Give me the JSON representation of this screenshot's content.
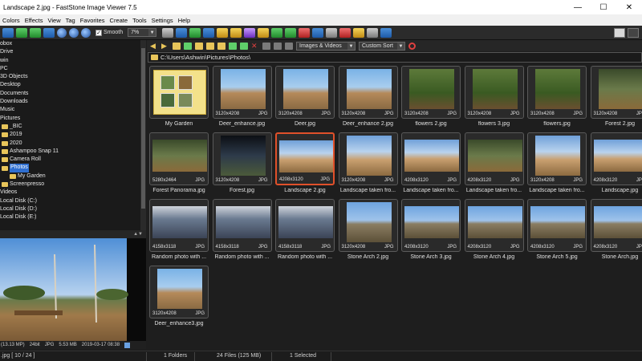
{
  "window": {
    "title": "Landscape 2.jpg  -  FastStone Image Viewer 7.5",
    "minimize": "—",
    "maximize": "☐",
    "close": "✕"
  },
  "menu": [
    "Colors",
    "Effects",
    "View",
    "Tag",
    "Favorites",
    "Create",
    "Tools",
    "Settings",
    "Help"
  ],
  "toolbar": {
    "smooth_label": "Smooth",
    "smooth_checked": "✓",
    "zoom_value": "7%"
  },
  "nav": {
    "view_mode": "Images & Videos",
    "sort": "Custom Sort"
  },
  "path": "C:\\Users\\Ashwin\\Pictures\\Photos\\",
  "tree": [
    {
      "label": "obox",
      "indent": 0,
      "folder": false
    },
    {
      "label": "Drive",
      "indent": 0,
      "folder": false
    },
    {
      "label": "win",
      "indent": 0,
      "folder": false
    },
    {
      "label": "PC",
      "indent": 0,
      "folder": false
    },
    {
      "label": "3D Objects",
      "indent": 0,
      "folder": false
    },
    {
      "label": "Desktop",
      "indent": 0,
      "folder": false
    },
    {
      "label": "Documents",
      "indent": 0,
      "folder": false
    },
    {
      "label": "Downloads",
      "indent": 0,
      "folder": false
    },
    {
      "label": "Music",
      "indent": 0,
      "folder": false
    },
    {
      "label": "Pictures",
      "indent": 0,
      "folder": false
    },
    {
      "label": "_BIC",
      "indent": 1,
      "folder": true
    },
    {
      "label": "2019",
      "indent": 1,
      "folder": true
    },
    {
      "label": "2020",
      "indent": 1,
      "folder": true
    },
    {
      "label": "Ashampoo Snap 11",
      "indent": 1,
      "folder": true
    },
    {
      "label": "Camera Roll",
      "indent": 1,
      "folder": true
    },
    {
      "label": "Photos",
      "indent": 1,
      "folder": true,
      "selected": true
    },
    {
      "label": "My Garden",
      "indent": 2,
      "folder": true
    },
    {
      "label": "Screenpresso",
      "indent": 1,
      "folder": true
    },
    {
      "label": "Videos",
      "indent": 0,
      "folder": false
    },
    {
      "label": "Local Disk (C:)",
      "indent": 0,
      "folder": false
    },
    {
      "label": "Local Disk (D:)",
      "indent": 0,
      "folder": false
    },
    {
      "label": "Local Disk (E:)",
      "indent": 0,
      "folder": false
    }
  ],
  "preview_info": {
    "megapixels": "(13.13 MP)",
    "bitdepth": "24bit",
    "format": "JPG",
    "size": "5.53 MB",
    "date": "2019-03-17 08:38",
    "index": ".jpg [ 10 / 24 ]"
  },
  "thumbnails": [
    {
      "name": "My Garden",
      "dims": "",
      "ext": "",
      "kind": "folder"
    },
    {
      "name": "Deer_enhance.jpg",
      "dims": "3120x4208",
      "ext": "JPG",
      "kind": "img-sky"
    },
    {
      "name": "Deer.jpg",
      "dims": "3120x4208",
      "ext": "JPG",
      "kind": "img-sky"
    },
    {
      "name": "Deer_enhance 2.jpg",
      "dims": "3120x4208",
      "ext": "JPG",
      "kind": "img-sky"
    },
    {
      "name": "flowers 2.jpg",
      "dims": "3120x4208",
      "ext": "JPG",
      "kind": "img-green"
    },
    {
      "name": "flowers 3.jpg",
      "dims": "3120x4208",
      "ext": "JPG",
      "kind": "img-green"
    },
    {
      "name": "flowers.jpg",
      "dims": "3120x4208",
      "ext": "JPG",
      "kind": "img-green"
    },
    {
      "name": "Forest 2.jpg",
      "dims": "3120x4208",
      "ext": "JPG",
      "kind": "img-forest"
    },
    {
      "name": "Forest Panorama.jpg",
      "dims": "5280x2464",
      "ext": "JPG",
      "kind": "img-forest",
      "wide": true
    },
    {
      "name": "Forest.jpg",
      "dims": "3120x4208",
      "ext": "JPG",
      "kind": "img-dark"
    },
    {
      "name": "Landscape 2.jpg",
      "dims": "4208x3120",
      "ext": "JPG",
      "kind": "img-landscape",
      "wide": true,
      "selected": true
    },
    {
      "name": "Landscape taken fro...",
      "dims": "3120x4208",
      "ext": "JPG",
      "kind": "img-landscape"
    },
    {
      "name": "Landscape taken fro...",
      "dims": "4208x3120",
      "ext": "JPG",
      "kind": "img-landscape",
      "wide": true
    },
    {
      "name": "Landscape taken fro...",
      "dims": "4208x3120",
      "ext": "JPG",
      "kind": "img-forest",
      "wide": true
    },
    {
      "name": "Landscape taken fro...",
      "dims": "3120x4208",
      "ext": "JPG",
      "kind": "img-landscape"
    },
    {
      "name": "Landscape.jpg",
      "dims": "4208x3120",
      "ext": "JPG",
      "kind": "img-landscape",
      "wide": true
    },
    {
      "name": "Random photo with ...",
      "dims": "4158x3118",
      "ext": "JPG",
      "kind": "img-room",
      "wide": true
    },
    {
      "name": "Random photo with ...",
      "dims": "4158x3118",
      "ext": "JPG",
      "kind": "img-room",
      "wide": true
    },
    {
      "name": "Random photo with ...",
      "dims": "4158x3118",
      "ext": "JPG",
      "kind": "img-room",
      "wide": true
    },
    {
      "name": "Stone Arch 2.jpg",
      "dims": "3120x4208",
      "ext": "JPG",
      "kind": "img-rock"
    },
    {
      "name": "Stone Arch 3.jpg",
      "dims": "4208x3120",
      "ext": "JPG",
      "kind": "img-rock",
      "wide": true
    },
    {
      "name": "Stone Arch 4.jpg",
      "dims": "4208x3120",
      "ext": "JPG",
      "kind": "img-rock",
      "wide": true
    },
    {
      "name": "Stone Arch 5.jpg",
      "dims": "4208x3120",
      "ext": "JPG",
      "kind": "img-rock",
      "wide": true
    },
    {
      "name": "Stone Arch.jpg",
      "dims": "4208x3120",
      "ext": "JPG",
      "kind": "img-rock",
      "wide": true
    },
    {
      "name": "Deer_enhance3.jpg",
      "dims": "3120x4208",
      "ext": "JPG",
      "kind": "img-sky"
    }
  ],
  "status": {
    "folders": "1 Folders",
    "files": "24 Files (125 MB)",
    "selected": "1 Selected"
  },
  "colors": {
    "selection_border": "#e0502a",
    "tree_selection": "#2f6fd0",
    "folder": "#e8c55a"
  }
}
